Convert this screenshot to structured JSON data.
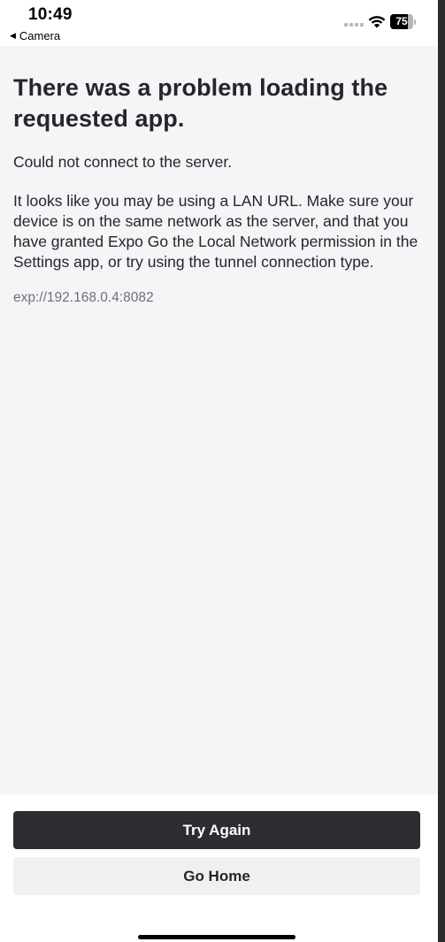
{
  "status_bar": {
    "time": "10:49",
    "back_label": "Camera",
    "battery_percent": "75",
    "battery_level": 0.75
  },
  "error": {
    "title": "There was a problem loading the requested app.",
    "message": "Could not connect to the server.",
    "details": "It looks like you may be using a LAN URL. Make sure your device is on the same network as the server, and that you have granted Expo Go the Local Network permission in the Settings app, or try using the tunnel connection type.",
    "url": "exp://192.168.0.4:8082"
  },
  "actions": {
    "try_again_label": "Try Again",
    "go_home_label": "Go Home"
  },
  "colors": {
    "primary_button": "#2b2d33",
    "secondary_button": "#f0f0f0",
    "content_background": "#f5f5f7"
  }
}
